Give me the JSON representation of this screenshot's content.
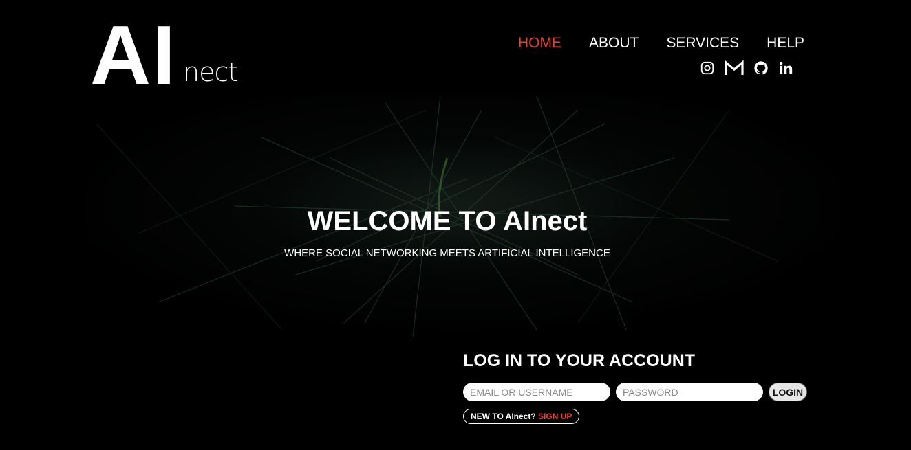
{
  "brand": {
    "logo_main": "AI",
    "logo_suffix": "nect"
  },
  "nav": {
    "items": [
      "HOME",
      "ABOUT",
      "SERVICES",
      "HELP"
    ],
    "active": "HOME",
    "active_color": "#e8402a"
  },
  "socials": [
    "instagram-icon",
    "gmail-icon",
    "github-icon",
    "linkedin-icon"
  ],
  "hero": {
    "title": "WELCOME TO AInect",
    "subtitle": "WHERE SOCIAL NETWORKING MEETS ARTIFICIAL INTELLIGENCE"
  },
  "login": {
    "title": "LOG IN TO YOUR ACCOUNT",
    "email_placeholder": "EMAIL OR USERNAME",
    "email_value": "",
    "password_placeholder": "PASSWORD",
    "password_value": "",
    "button_label": "LOGIN",
    "signup_prompt": "NEW TO AInect?",
    "signup_link": "SIGN UP"
  },
  "colors": {
    "background": "#000000",
    "accent": "#e8402a",
    "text": "#ffffff"
  }
}
